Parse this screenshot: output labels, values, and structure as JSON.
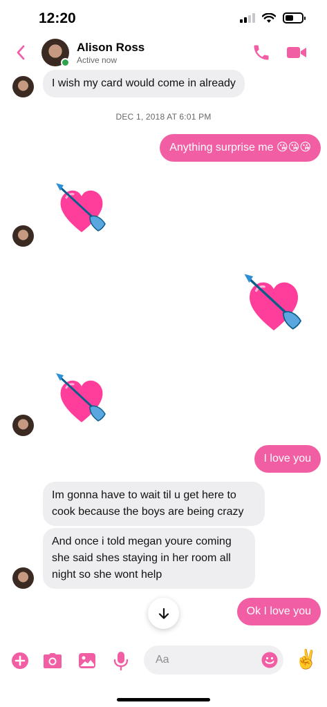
{
  "status_bar": {
    "time": "12:20",
    "battery_level": 0.5
  },
  "header": {
    "contact_name": "Alison Ross",
    "contact_status": "Active now",
    "accent_color": "#f25ea3"
  },
  "conversation": {
    "timestamp": "DEC 1, 2018 AT 6:01 PM",
    "messages": [
      {
        "direction": "incoming",
        "text": "I wish my card would come in already"
      },
      {
        "direction": "outgoing",
        "text": "Anything surprise me 😘😘😘"
      },
      {
        "direction": "incoming",
        "sticker": "heart-with-arrow-icon"
      },
      {
        "direction": "outgoing",
        "sticker": "heart-with-arrow-icon"
      },
      {
        "direction": "incoming",
        "sticker": "heart-with-arrow-icon"
      },
      {
        "direction": "outgoing",
        "text": "I love you"
      },
      {
        "direction": "incoming",
        "text": "Im gonna have to wait til u get here to cook because the boys are being crazy"
      },
      {
        "direction": "incoming",
        "text": "And once i told megan youre coming she said shes staying in her room all night so she wont help"
      },
      {
        "direction": "outgoing",
        "text": "Ok I love you"
      }
    ]
  },
  "composer": {
    "placeholder": "Aa",
    "like_glyph": "✌️",
    "icons": [
      "plus-icon",
      "camera-icon",
      "gallery-icon",
      "microphone-icon",
      "emoji-icon"
    ]
  },
  "colors": {
    "accent": "#f25ea3",
    "incoming_bubble": "#eeeef0",
    "online": "#31a24c"
  }
}
